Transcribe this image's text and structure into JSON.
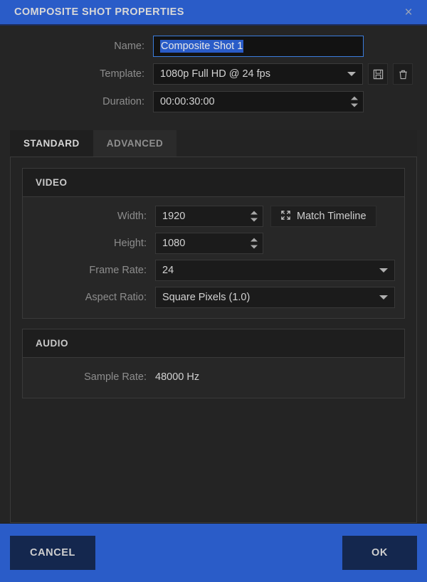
{
  "titlebar": {
    "title": "COMPOSITE SHOT PROPERTIES",
    "close_label": "×"
  },
  "topform": {
    "name": {
      "label": "Name:",
      "value": "Composite Shot 1"
    },
    "template": {
      "label": "Template:",
      "value": "1080p Full HD @ 24 fps",
      "save_icon": "save-icon",
      "delete_icon": "trash-icon"
    },
    "duration": {
      "label": "Duration:",
      "value": "00:00:30:00"
    }
  },
  "tabs": [
    {
      "label": "STANDARD",
      "active": true
    },
    {
      "label": "ADVANCED",
      "active": false
    }
  ],
  "video": {
    "header": "VIDEO",
    "width": {
      "label": "Width:",
      "value": "1920"
    },
    "match_timeline": {
      "label": "Match Timeline",
      "icon": "expand-arrows-icon"
    },
    "height": {
      "label": "Height:",
      "value": "1080"
    },
    "frame_rate": {
      "label": "Frame Rate:",
      "value": "24"
    },
    "aspect_ratio": {
      "label": "Aspect Ratio:",
      "value": "Square Pixels (1.0)"
    }
  },
  "audio": {
    "header": "AUDIO",
    "sample_rate": {
      "label": "Sample Rate:",
      "value": "48000 Hz"
    }
  },
  "footer": {
    "cancel_label": "CANCEL",
    "ok_label": "OK"
  },
  "colors": {
    "accent_blue": "#2a5cc8",
    "button_navy": "#14274e",
    "panel_bg": "#252525",
    "field_bg": "#1b1b1b",
    "label_gray": "#8d8d8d",
    "focus_border": "#3b7ddd"
  }
}
